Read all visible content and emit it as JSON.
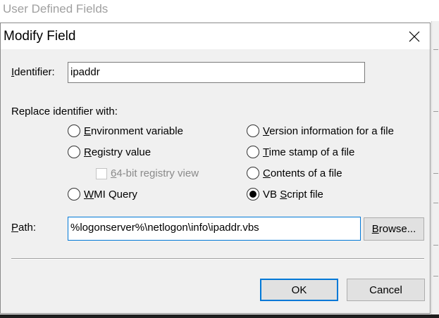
{
  "parent": {
    "title": "User Defined Fields"
  },
  "dialog": {
    "title": "Modify Field",
    "identifier": {
      "label_mnemonic": "I",
      "label_rest": "dentifier:",
      "value": "ipaddr"
    },
    "replace_label": "Replace identifier with:",
    "options": {
      "environment_variable": {
        "mnemonic": "E",
        "rest": "nvironment variable",
        "checked": false
      },
      "registry_value": {
        "mnemonic": "R",
        "rest": "egistry value",
        "checked": false
      },
      "registry_64bit": {
        "mnemonic": "6",
        "rest": "4-bit registry view",
        "checked": false,
        "enabled": false
      },
      "wmi_query": {
        "mnemonic": "W",
        "rest": "MI Query",
        "checked": false
      },
      "version_info": {
        "mnemonic": "V",
        "rest": "ersion information for a file",
        "checked": false
      },
      "time_stamp": {
        "mnemonic": "T",
        "rest": "ime stamp of a file",
        "checked": false
      },
      "contents_file": {
        "mnemonic": "C",
        "rest": "ontents of a file",
        "checked": false
      },
      "vb_script": {
        "pre": "VB ",
        "mnemonic": "S",
        "rest": "cript file",
        "checked": true
      }
    },
    "path": {
      "label_mnemonic": "P",
      "label_rest": "ath:",
      "value": "%logonserver%\\netlogon\\info\\ipaddr.vbs"
    },
    "buttons": {
      "browse_mnemonic": "B",
      "browse_rest": "rowse...",
      "ok": "OK",
      "cancel": "Cancel"
    }
  }
}
